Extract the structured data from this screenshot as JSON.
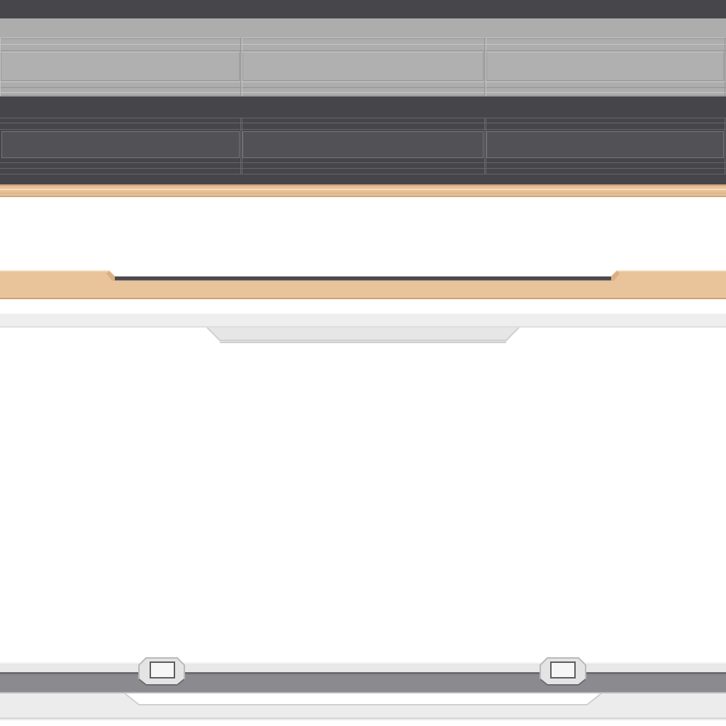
{
  "sheet": {
    "strips": [
      {
        "id": "top-dark-bar",
        "color": "#47474b"
      },
      {
        "id": "light-panel-grid",
        "color": "#adadad",
        "columns": 3
      },
      {
        "id": "dark-panel-grid",
        "color": "#46464a",
        "columns": 3
      },
      {
        "id": "tan-edge",
        "color": "#e9c49b"
      },
      {
        "id": "tan-beveled-frame",
        "color": "#e9c49b",
        "inset_color": "#4a4a4e"
      },
      {
        "id": "light-grey-beveled-tab",
        "color": "#e6e6e6"
      },
      {
        "id": "bottom-notched-bar",
        "color": "#8a8a8f",
        "notches": 2
      }
    ],
    "colors": {
      "dark": "#47474b",
      "mid_grey": "#adadad",
      "tan": "#e9c49b",
      "light_grey": "#eeeeee",
      "slate": "#8a8a8f",
      "background": "#ffffff"
    }
  }
}
